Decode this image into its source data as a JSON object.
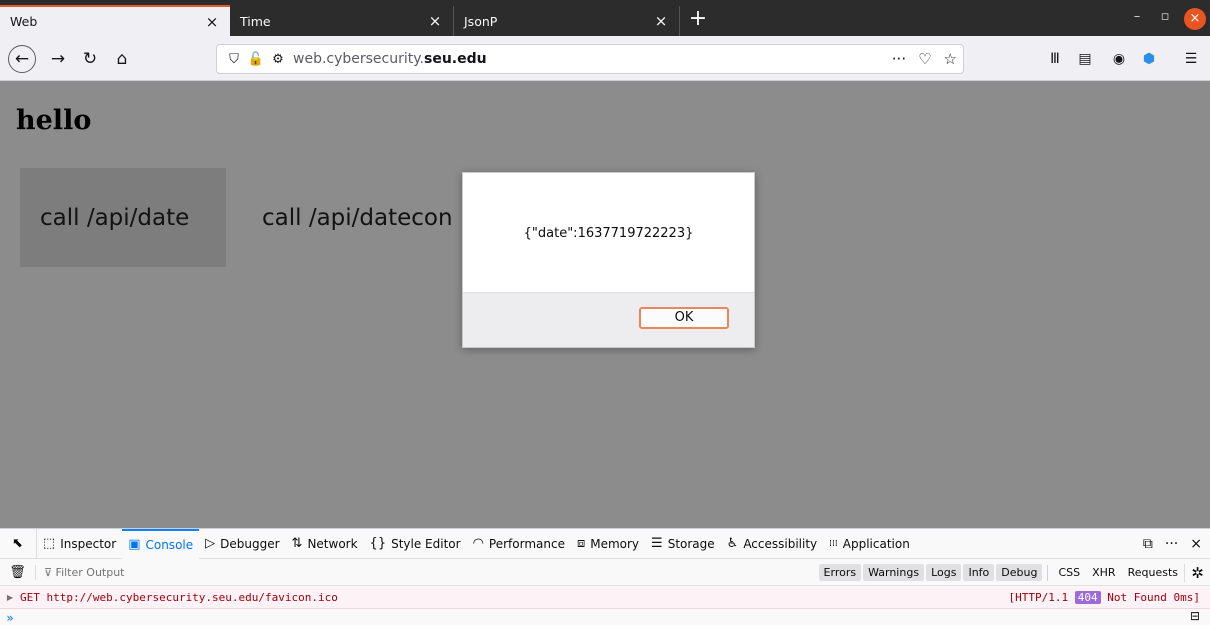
{
  "tabs": [
    {
      "label": "Web",
      "close": "×"
    },
    {
      "label": "Time",
      "close": "×"
    },
    {
      "label": "JsonP",
      "close": "×"
    }
  ],
  "new_tab": "+",
  "window_controls": {
    "minimize": "–",
    "maximize": "▫",
    "close": "×"
  },
  "nav": {
    "back": "←",
    "forward": "→",
    "reload": "↻",
    "home": "⌂",
    "url_prefix": "web.cybersecurity.",
    "url_host": "seu.edu",
    "shield_icon": "⛉",
    "insecure_icon": "🔓",
    "perm_icon": "⚙",
    "page_actions": "···",
    "pocket": "♡",
    "bookmark": "☆",
    "library": "Ⅲ",
    "sidebar": "▤",
    "account": "◉",
    "extension": "⬢",
    "menu": "☰"
  },
  "page": {
    "heading": "hello",
    "button1": "call /api/date",
    "button2": "call /api/datecon"
  },
  "dialog": {
    "message": "{\"date\":1637719722223}",
    "ok_label": "OK"
  },
  "devtools": {
    "picker": "⬉",
    "tabs": [
      {
        "icon": "⬚",
        "label": "Inspector"
      },
      {
        "icon": "▣",
        "label": "Console"
      },
      {
        "icon": "▷",
        "label": "Debugger"
      },
      {
        "icon": "⇅",
        "label": "Network"
      },
      {
        "icon": "{}",
        "label": "Style Editor"
      },
      {
        "icon": "◠",
        "label": "Performance"
      },
      {
        "icon": "⧈",
        "label": "Memory"
      },
      {
        "icon": "☰",
        "label": "Storage"
      },
      {
        "icon": "♿",
        "label": "Accessibility"
      },
      {
        "icon": "⁞⁞⁞",
        "label": "Application"
      }
    ],
    "selected_tab": "Console",
    "right_tools": {
      "dock": "⧉",
      "more": "···",
      "close": "×"
    },
    "trash": "🗑",
    "filter_placeholder": "⊽ Filter Output",
    "filters": [
      "Errors",
      "Warnings",
      "Logs",
      "Info",
      "Debug"
    ],
    "extra_filters": [
      "CSS",
      "XHR",
      "Requests"
    ],
    "settings": "✲",
    "log": {
      "request": "GET http://web.cybersecurity.seu.edu/favicon.ico",
      "status_prefix": "[HTTP/1.1",
      "status_code": "404",
      "status_suffix": "Not Found 0ms]"
    },
    "prompt": "»",
    "split_console": "⊟"
  }
}
